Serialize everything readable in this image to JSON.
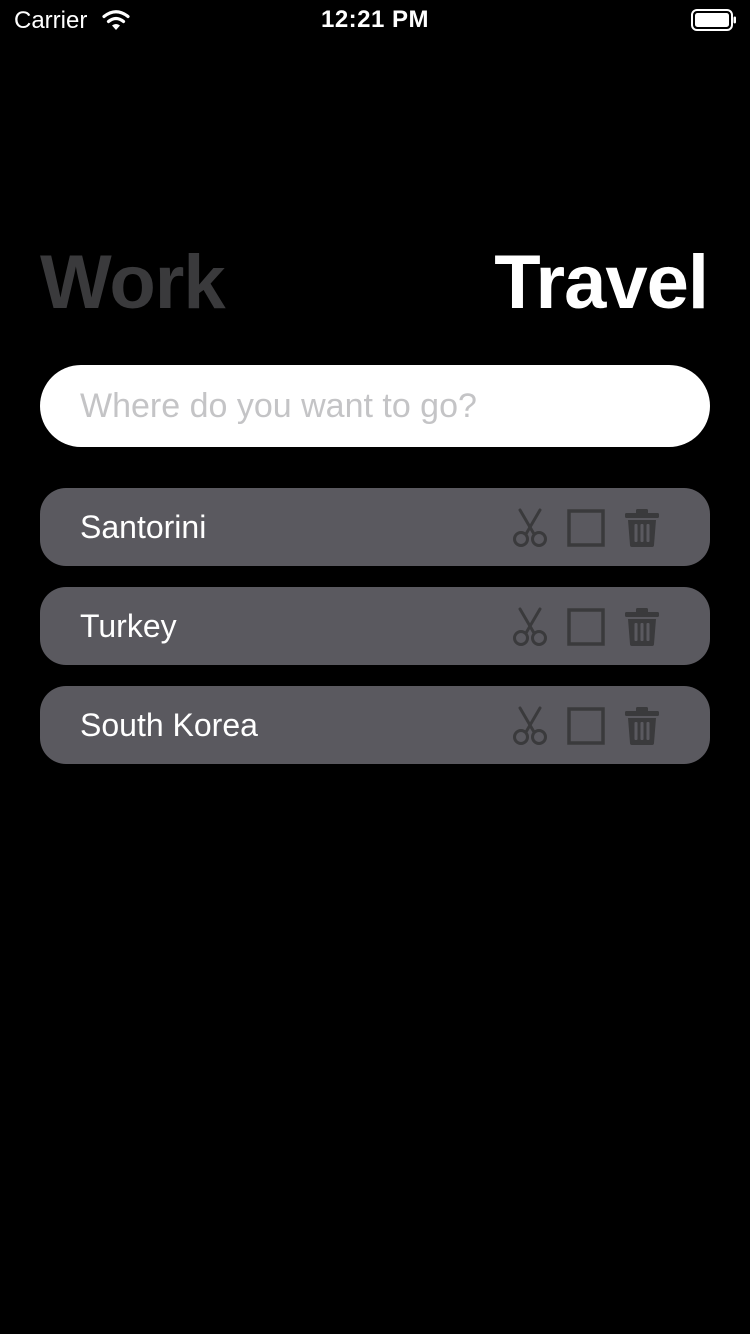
{
  "status_bar": {
    "carrier": "Carrier",
    "time": "12:21 PM"
  },
  "header": {
    "tabs": [
      {
        "label": "Work",
        "active": false
      },
      {
        "label": "Travel",
        "active": true
      }
    ]
  },
  "search": {
    "value": "",
    "placeholder": "Where do you want to go?"
  },
  "todos": [
    {
      "text": "Santorini",
      "done": false
    },
    {
      "text": "Turkey",
      "done": false
    },
    {
      "text": "South Korea",
      "done": false
    }
  ],
  "icons": {
    "edit": "scissors-icon",
    "complete": "checkbox-icon",
    "delete": "trash-icon"
  },
  "colors": {
    "background": "#000000",
    "inactive_tab": "#3a3a3c",
    "active_tab": "#ffffff",
    "item_background": "#5a595f",
    "icon": "#3a3a3c"
  }
}
